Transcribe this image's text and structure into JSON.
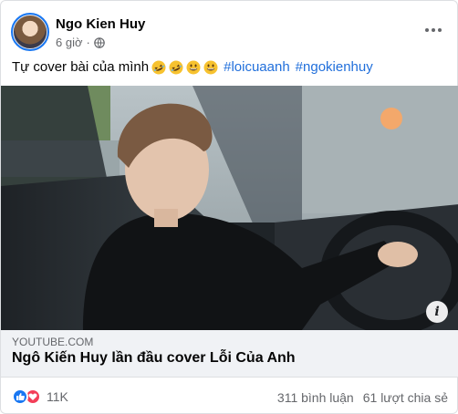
{
  "post": {
    "author": "Ngo Kien Huy",
    "time": "6 giờ",
    "text_plain": "Tự cover bài của mình",
    "emojis": [
      "rolling-on-floor-laughing",
      "rolling-on-floor-laughing",
      "grinning-face",
      "grinning-face"
    ],
    "hashtags": [
      "#loicuaanh",
      "#ngokienhuy"
    ]
  },
  "link_preview": {
    "domain": "YOUTUBE.COM",
    "title": "Ngô Kiến Huy lần đầu cover Lỗi Của Anh",
    "info_icon": "i"
  },
  "footer": {
    "reaction_count": "11K",
    "comments": "311 bình luận",
    "shares": "61 lượt chia sẻ"
  },
  "colors": {
    "hashtag": "#216fdb",
    "like": "#1877f2",
    "love": "#f33e58",
    "secondary_text": "#65676b"
  }
}
